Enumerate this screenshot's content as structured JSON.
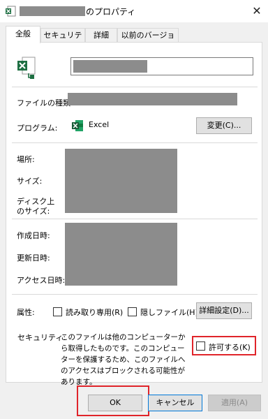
{
  "window": {
    "title_suffix": "のプロパティ",
    "close_glyph": "✕"
  },
  "tabs": [
    {
      "label": "全般",
      "active": true
    },
    {
      "label": "セキュリティ",
      "active": false
    },
    {
      "label": "詳細",
      "active": false
    },
    {
      "label": "以前のバージョン",
      "active": false
    }
  ],
  "general": {
    "file_type_label": "ファイルの種類:",
    "program_label": "プログラム:",
    "program_name": "Excel",
    "change_button": "変更(C)...",
    "location_label": "場所:",
    "size_label": "サイズ:",
    "disk_size_label_line1": "ディスク上",
    "disk_size_label_line2": "のサイズ:",
    "created_label": "作成日時:",
    "modified_label": "更新日時:",
    "accessed_label": "アクセス日時:",
    "attributes_label": "属性:",
    "readonly_label": "読み取り専用(R)",
    "hidden_label": "隠しファイル(H)",
    "advanced_button": "詳細設定(D)..."
  },
  "security": {
    "label": "セキュリティ:",
    "message": "このファイルは他のコンピューターから取得したものです。このコンピューターを保護するため、このファイルへのアクセスはブロックされる可能性があります。",
    "allow_label": "許可する(K)"
  },
  "buttons": {
    "ok": "OK",
    "cancel": "キャンセル",
    "apply": "適用(A)"
  },
  "colors": {
    "excel_green": "#1d6f42",
    "highlight_red": "#e0242a",
    "redaction_gray": "#8c8c8c"
  }
}
